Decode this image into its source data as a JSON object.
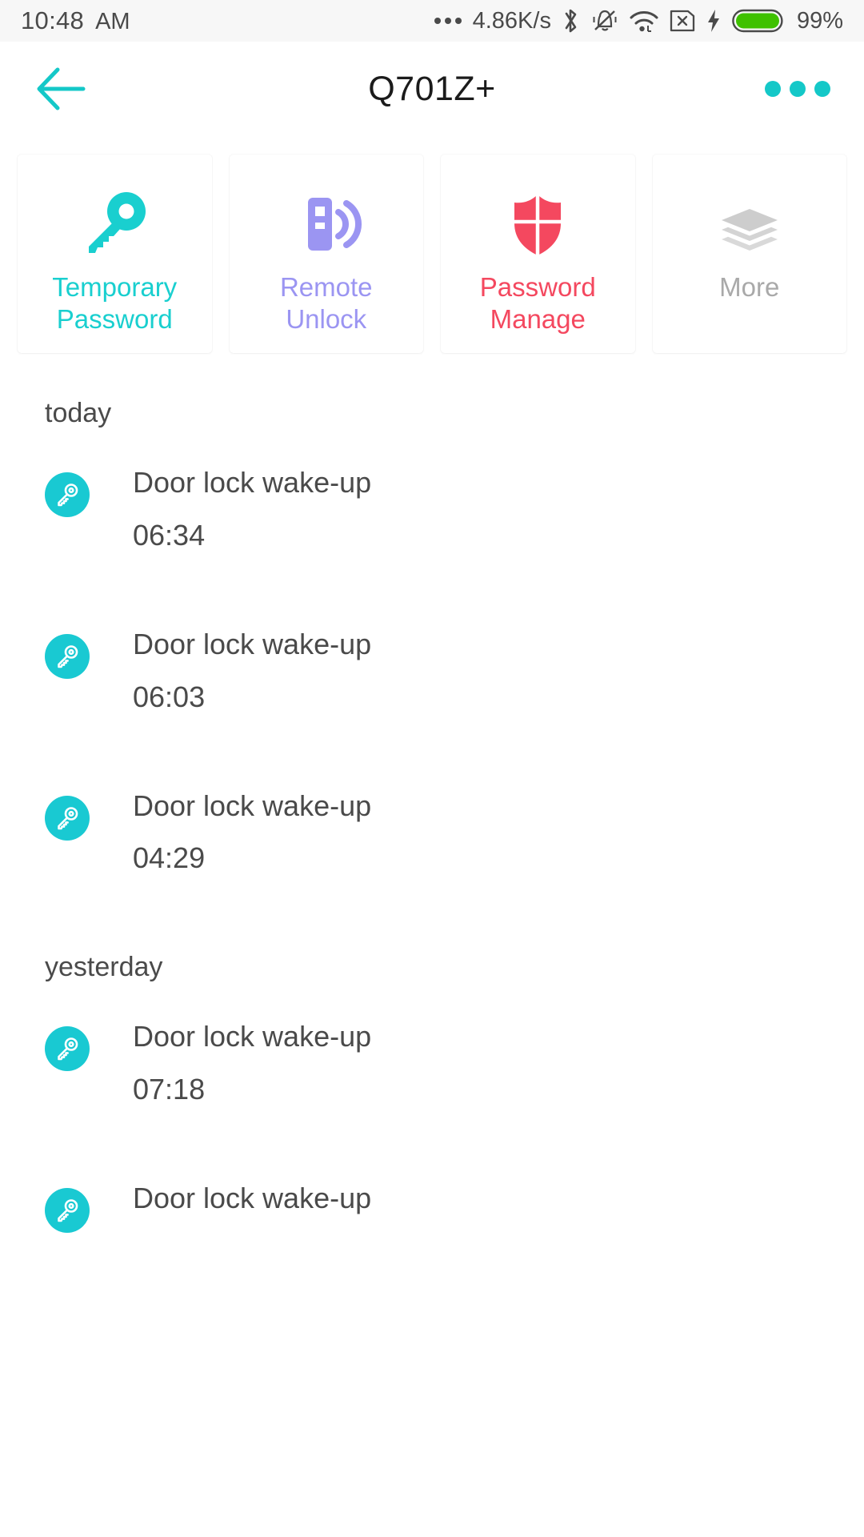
{
  "status_bar": {
    "time": "10:48",
    "ampm": "AM",
    "network_speed": "4.86K/s",
    "battery_percent": "99%",
    "icons": [
      "ellipsis-icon",
      "bluetooth-icon",
      "mute-vibrate-icon",
      "wifi-icon",
      "sim-card-error-icon",
      "charging-bolt-icon",
      "battery-icon"
    ],
    "battery_color": "#3fc100"
  },
  "app_bar": {
    "title": "Q701Z+",
    "back_icon": "back-arrow-icon",
    "overflow_icon": "more-options-icon",
    "accent_color": "#14c8c8"
  },
  "actions": [
    {
      "label": "Temporary\nPassword",
      "icon": "key-icon",
      "color": "#19cfcf"
    },
    {
      "label": "Remote\nUnlock",
      "icon": "remote-unlock-icon",
      "color": "#9b95f2"
    },
    {
      "label": "Password\nManage",
      "icon": "shield-icon",
      "color": "#f4485f"
    },
    {
      "label": "More",
      "icon": "layers-icon",
      "color": "#a9a9a9"
    }
  ],
  "timeline": [
    {
      "day": "today",
      "entries": [
        {
          "title": "Door lock wake-up",
          "time": "06:34",
          "icon": "key-badge-icon"
        },
        {
          "title": "Door lock wake-up",
          "time": "06:03",
          "icon": "key-badge-icon"
        },
        {
          "title": "Door lock wake-up",
          "time": "04:29",
          "icon": "key-badge-icon"
        }
      ]
    },
    {
      "day": "yesterday",
      "entries": [
        {
          "title": "Door lock wake-up",
          "time": "07:18",
          "icon": "key-badge-icon"
        },
        {
          "title": "Door lock wake-up",
          "time": "",
          "icon": "key-badge-icon"
        }
      ]
    }
  ],
  "colors": {
    "badge_teal": "#19c9d2",
    "text_dark": "#4a4a4a",
    "page_bg": "#ffffff"
  }
}
